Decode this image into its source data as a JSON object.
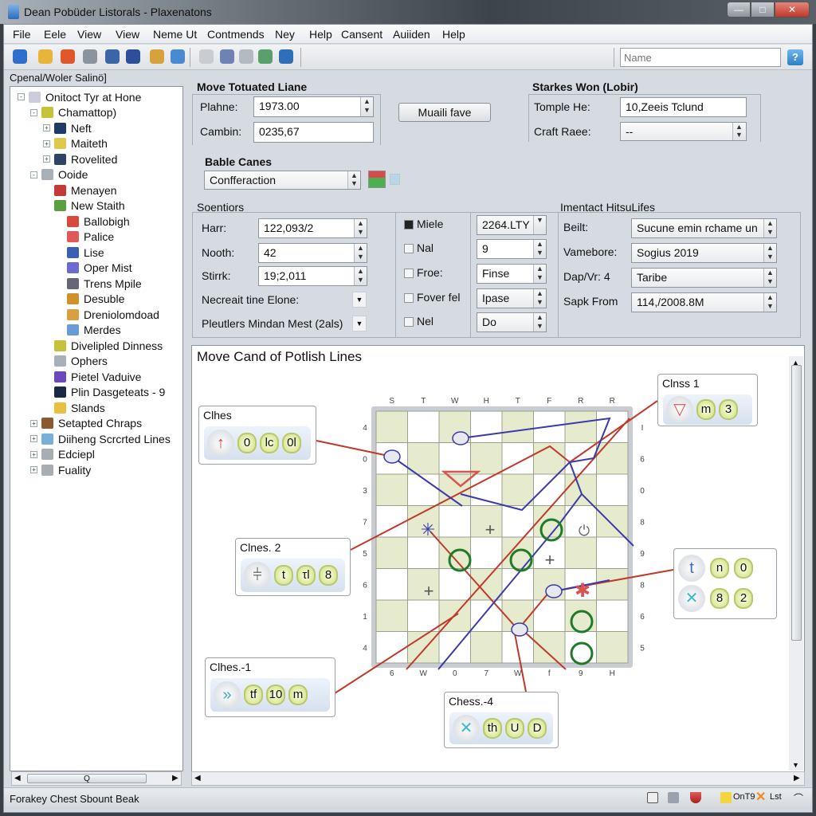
{
  "window": {
    "title": "Dean Pobüder Listorals - Plaxenatons"
  },
  "menu": [
    "File",
    "Eele",
    "View",
    "View",
    "Neme Ut",
    "Contmends",
    "Ney",
    "Help",
    "Cansent",
    "Auiiden",
    "Help"
  ],
  "toolbar": {
    "icons": [
      "back-icon",
      "folder-open-icon",
      "record-icon",
      "link-icon",
      "save-icon",
      "media-icon",
      "clipboard-icon",
      "merge-icon",
      "paste-icon",
      "delete-icon",
      "pin-icon",
      "edit-icon",
      "export-icon"
    ],
    "search_placeholder": "Name",
    "help_label": "?"
  },
  "tree": {
    "header": "Cpenal/Woler Salinö]",
    "items": [
      {
        "label": "Onitoct Tyr at Hone",
        "level": 0,
        "icon": "node-icon",
        "expander": "-"
      },
      {
        "label": "Chamattop)",
        "level": 1,
        "icon": "folder-green-icon",
        "expander": "-"
      },
      {
        "label": "Neft",
        "level": 2,
        "icon": "plus-tile-icon",
        "expander": "+"
      },
      {
        "label": "Maiteth",
        "level": 2,
        "icon": "mail-icon",
        "expander": "+"
      },
      {
        "label": "Rovelited",
        "level": 2,
        "icon": "device-icon",
        "expander": "+"
      },
      {
        "label": "Ooide",
        "level": 1,
        "icon": "drive-icon",
        "expander": "-"
      },
      {
        "label": "Menayen",
        "level": 2,
        "icon": "red-tile-icon"
      },
      {
        "label": "New Staith",
        "level": 2,
        "icon": "green-tile-icon"
      },
      {
        "label": "Ballobigh",
        "level": 3,
        "icon": "crab-icon"
      },
      {
        "label": "Palice",
        "level": 3,
        "icon": "shield-icon"
      },
      {
        "label": "Lise",
        "level": 3,
        "icon": "list-icon"
      },
      {
        "label": "Oper Mist",
        "level": 3,
        "icon": "gear-icon"
      },
      {
        "label": "Trens Mpile",
        "level": 3,
        "icon": "transfer-icon"
      },
      {
        "label": "Desuble",
        "level": 3,
        "icon": "puzzle-icon"
      },
      {
        "label": "Dreniolomdoad",
        "level": 3,
        "icon": "download-icon"
      },
      {
        "label": "Merdes",
        "level": 3,
        "icon": "merge-icon"
      },
      {
        "label": "Divelipled Dinness",
        "level": 2,
        "icon": "folder-green-icon"
      },
      {
        "label": "Ophers",
        "level": 2,
        "icon": "drive-icon"
      },
      {
        "label": "Pietel Vaduive",
        "level": 2,
        "icon": "purple-ball-icon"
      },
      {
        "label": "Plin Dasgeteats - 9",
        "level": 2,
        "icon": "monitor-icon"
      },
      {
        "label": "Slands",
        "level": 2,
        "icon": "moon-icon"
      },
      {
        "label": "Setapted Chraps",
        "level": 1,
        "icon": "guitar-icon",
        "expander": "+"
      },
      {
        "label": "Diiheng Scrcrted Lines",
        "level": 1,
        "icon": "chart-icon",
        "expander": "+"
      },
      {
        "label": "Edciepl",
        "level": 1,
        "icon": "folder-icon",
        "expander": "+"
      },
      {
        "label": "Fuality",
        "level": 1,
        "icon": "folder-icon",
        "expander": "+"
      }
    ],
    "hscroll_label": "Q"
  },
  "move_panel": {
    "title": "Move Totuated Liane",
    "fields": [
      {
        "label": "Plahne:",
        "value": "1973.00",
        "spinner": true
      },
      {
        "label": "Cambin:",
        "value": "0235,67",
        "spinner": false
      }
    ],
    "button": "Muaili fave"
  },
  "babl": {
    "title": "Bable Canes",
    "value": "Confferaction"
  },
  "stakes_panel": {
    "title": "Starkes Won (Lobir)",
    "fields": [
      {
        "label": "Tomple He:",
        "value": "10,Zeeis Tclund"
      },
      {
        "label": "Craft Raee:",
        "value": "--"
      }
    ]
  },
  "sections": {
    "title": "Soentiors",
    "fields": [
      {
        "label": "Harr:",
        "value": "122,093/2"
      },
      {
        "label": "Nooth:",
        "value": "42"
      },
      {
        "label": "Stirrk:",
        "value": "19;2,011"
      }
    ],
    "dropdowns": [
      {
        "label": "Necreait tine Elone:"
      },
      {
        "label": "Pleutlers Mindan Mest (2als)"
      }
    ],
    "checks": [
      {
        "label": "Miele",
        "checked": true
      },
      {
        "label": "Nal",
        "checked": false
      },
      {
        "label": "Froe:",
        "checked": false
      },
      {
        "label": "Fover fel",
        "checked": false
      },
      {
        "label": "Nel",
        "checked": false
      }
    ],
    "right_values": [
      "2264.LTY",
      "9",
      "Finse",
      "Ipase",
      "Do"
    ]
  },
  "contact": {
    "title": "Imentact HitsuLifes",
    "fields": [
      {
        "label": "Beilt:",
        "value": "Sucune emin rchame un"
      },
      {
        "label": "Vamebore:",
        "value": "Sogius 2019"
      },
      {
        "label": "Dap/Vr: 4",
        "value": "Taribe"
      },
      {
        "label": "Sapk From",
        "value": "114,/2008.8M"
      }
    ]
  },
  "diagram": {
    "title": "Move Cand of Potlish Lines",
    "top_labels": [
      "S",
      "T",
      "W",
      "H",
      "T",
      "F",
      "R",
      "R"
    ],
    "bottom_labels": [
      "6",
      "W",
      "0",
      "7",
      "W",
      "f",
      "9",
      "H"
    ],
    "left_labels": [
      "4",
      "0",
      "3",
      "7",
      "5",
      "6",
      "1",
      "4"
    ],
    "right_labels": [
      "I",
      "6",
      "0",
      "8",
      "9",
      "8",
      "6",
      "5"
    ],
    "callouts": [
      {
        "title": "Clhes",
        "chips": [
          "0",
          "lc",
          "0l"
        ],
        "icon": "red-arrow-icon"
      },
      {
        "title": "Clnss 1",
        "chips": [
          "m",
          "3"
        ],
        "icon": "crown-icon"
      },
      {
        "title": "Clnes. 2",
        "chips": [
          "t",
          "τl",
          "8"
        ],
        "icon": "chevron-stack-icon"
      },
      {
        "title": "",
        "chips_row1": [
          "n",
          "0"
        ],
        "chips_row2": [
          "8",
          "2"
        ],
        "icon1": "t-icon",
        "icon2": "x-icon"
      },
      {
        "title": "Clhes.-1",
        "chips": [
          "tf",
          "10",
          "m"
        ],
        "icon": "fast-forward-icon"
      },
      {
        "title": "Chess.-4",
        "chips": [
          "th",
          "U",
          "D"
        ],
        "icon": "x-icon"
      }
    ]
  },
  "status": {
    "text": "Forakey Chest Sbount Beak",
    "tray": [
      "OnT9",
      "Lst"
    ]
  }
}
